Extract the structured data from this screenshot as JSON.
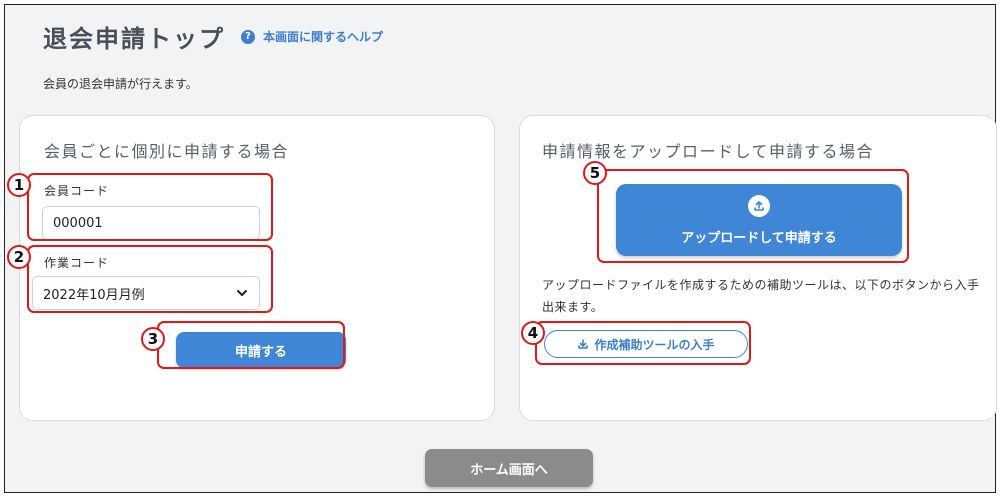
{
  "header": {
    "title": "退会申請トップ",
    "help_icon": "?",
    "help_label": "本画面に関するヘルプ",
    "description": "会員の退会申請が行えます。"
  },
  "left_card": {
    "title": "会員ごとに個別に申請する場合",
    "member_code_label": "会員コード",
    "member_code_value": "000001",
    "work_code_label": "作業コード",
    "work_code_selected": "2022年10月月例",
    "submit_label": "申請する"
  },
  "right_card": {
    "title": "申請情報をアップロードして申請する場合",
    "upload_label": "アップロードして申請する",
    "description": "アップロードファイルを作成するための補助ツールは、以下のボタンから入手出来ます。",
    "tool_label": "作成補助ツールの入手"
  },
  "footer": {
    "home_label": "ホーム画面へ"
  },
  "markers": [
    "1",
    "2",
    "3",
    "4",
    "5"
  ],
  "colors": {
    "primary": "#3f87d6",
    "highlight": "#e01818",
    "home_button": "#8b8b8b",
    "background": "#f2f3f5"
  },
  "icons": {
    "help": "question-circle-icon",
    "upload": "upload-icon",
    "download": "download-icon",
    "select": "chevron-down-icon"
  }
}
